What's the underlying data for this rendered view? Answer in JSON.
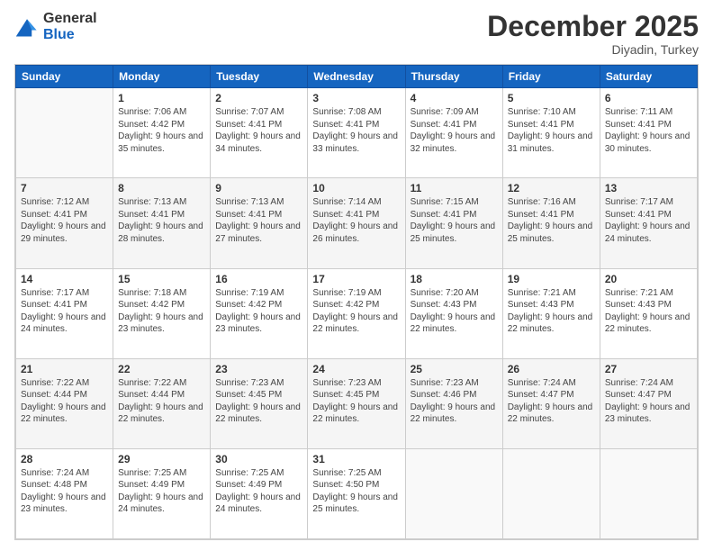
{
  "header": {
    "logo_general": "General",
    "logo_blue": "Blue",
    "month_title": "December 2025",
    "location": "Diyadin, Turkey"
  },
  "weekdays": [
    "Sunday",
    "Monday",
    "Tuesday",
    "Wednesday",
    "Thursday",
    "Friday",
    "Saturday"
  ],
  "weeks": [
    [
      {
        "day": "",
        "sunrise": "",
        "sunset": "",
        "daylight": "",
        "empty": true
      },
      {
        "day": "1",
        "sunrise": "Sunrise: 7:06 AM",
        "sunset": "Sunset: 4:42 PM",
        "daylight": "Daylight: 9 hours and 35 minutes."
      },
      {
        "day": "2",
        "sunrise": "Sunrise: 7:07 AM",
        "sunset": "Sunset: 4:41 PM",
        "daylight": "Daylight: 9 hours and 34 minutes."
      },
      {
        "day": "3",
        "sunrise": "Sunrise: 7:08 AM",
        "sunset": "Sunset: 4:41 PM",
        "daylight": "Daylight: 9 hours and 33 minutes."
      },
      {
        "day": "4",
        "sunrise": "Sunrise: 7:09 AM",
        "sunset": "Sunset: 4:41 PM",
        "daylight": "Daylight: 9 hours and 32 minutes."
      },
      {
        "day": "5",
        "sunrise": "Sunrise: 7:10 AM",
        "sunset": "Sunset: 4:41 PM",
        "daylight": "Daylight: 9 hours and 31 minutes."
      },
      {
        "day": "6",
        "sunrise": "Sunrise: 7:11 AM",
        "sunset": "Sunset: 4:41 PM",
        "daylight": "Daylight: 9 hours and 30 minutes."
      }
    ],
    [
      {
        "day": "7",
        "sunrise": "Sunrise: 7:12 AM",
        "sunset": "Sunset: 4:41 PM",
        "daylight": "Daylight: 9 hours and 29 minutes."
      },
      {
        "day": "8",
        "sunrise": "Sunrise: 7:13 AM",
        "sunset": "Sunset: 4:41 PM",
        "daylight": "Daylight: 9 hours and 28 minutes."
      },
      {
        "day": "9",
        "sunrise": "Sunrise: 7:13 AM",
        "sunset": "Sunset: 4:41 PM",
        "daylight": "Daylight: 9 hours and 27 minutes."
      },
      {
        "day": "10",
        "sunrise": "Sunrise: 7:14 AM",
        "sunset": "Sunset: 4:41 PM",
        "daylight": "Daylight: 9 hours and 26 minutes."
      },
      {
        "day": "11",
        "sunrise": "Sunrise: 7:15 AM",
        "sunset": "Sunset: 4:41 PM",
        "daylight": "Daylight: 9 hours and 25 minutes."
      },
      {
        "day": "12",
        "sunrise": "Sunrise: 7:16 AM",
        "sunset": "Sunset: 4:41 PM",
        "daylight": "Daylight: 9 hours and 25 minutes."
      },
      {
        "day": "13",
        "sunrise": "Sunrise: 7:17 AM",
        "sunset": "Sunset: 4:41 PM",
        "daylight": "Daylight: 9 hours and 24 minutes."
      }
    ],
    [
      {
        "day": "14",
        "sunrise": "Sunrise: 7:17 AM",
        "sunset": "Sunset: 4:41 PM",
        "daylight": "Daylight: 9 hours and 24 minutes."
      },
      {
        "day": "15",
        "sunrise": "Sunrise: 7:18 AM",
        "sunset": "Sunset: 4:42 PM",
        "daylight": "Daylight: 9 hours and 23 minutes."
      },
      {
        "day": "16",
        "sunrise": "Sunrise: 7:19 AM",
        "sunset": "Sunset: 4:42 PM",
        "daylight": "Daylight: 9 hours and 23 minutes."
      },
      {
        "day": "17",
        "sunrise": "Sunrise: 7:19 AM",
        "sunset": "Sunset: 4:42 PM",
        "daylight": "Daylight: 9 hours and 22 minutes."
      },
      {
        "day": "18",
        "sunrise": "Sunrise: 7:20 AM",
        "sunset": "Sunset: 4:43 PM",
        "daylight": "Daylight: 9 hours and 22 minutes."
      },
      {
        "day": "19",
        "sunrise": "Sunrise: 7:21 AM",
        "sunset": "Sunset: 4:43 PM",
        "daylight": "Daylight: 9 hours and 22 minutes."
      },
      {
        "day": "20",
        "sunrise": "Sunrise: 7:21 AM",
        "sunset": "Sunset: 4:43 PM",
        "daylight": "Daylight: 9 hours and 22 minutes."
      }
    ],
    [
      {
        "day": "21",
        "sunrise": "Sunrise: 7:22 AM",
        "sunset": "Sunset: 4:44 PM",
        "daylight": "Daylight: 9 hours and 22 minutes."
      },
      {
        "day": "22",
        "sunrise": "Sunrise: 7:22 AM",
        "sunset": "Sunset: 4:44 PM",
        "daylight": "Daylight: 9 hours and 22 minutes."
      },
      {
        "day": "23",
        "sunrise": "Sunrise: 7:23 AM",
        "sunset": "Sunset: 4:45 PM",
        "daylight": "Daylight: 9 hours and 22 minutes."
      },
      {
        "day": "24",
        "sunrise": "Sunrise: 7:23 AM",
        "sunset": "Sunset: 4:45 PM",
        "daylight": "Daylight: 9 hours and 22 minutes."
      },
      {
        "day": "25",
        "sunrise": "Sunrise: 7:23 AM",
        "sunset": "Sunset: 4:46 PM",
        "daylight": "Daylight: 9 hours and 22 minutes."
      },
      {
        "day": "26",
        "sunrise": "Sunrise: 7:24 AM",
        "sunset": "Sunset: 4:47 PM",
        "daylight": "Daylight: 9 hours and 22 minutes."
      },
      {
        "day": "27",
        "sunrise": "Sunrise: 7:24 AM",
        "sunset": "Sunset: 4:47 PM",
        "daylight": "Daylight: 9 hours and 23 minutes."
      }
    ],
    [
      {
        "day": "28",
        "sunrise": "Sunrise: 7:24 AM",
        "sunset": "Sunset: 4:48 PM",
        "daylight": "Daylight: 9 hours and 23 minutes."
      },
      {
        "day": "29",
        "sunrise": "Sunrise: 7:25 AM",
        "sunset": "Sunset: 4:49 PM",
        "daylight": "Daylight: 9 hours and 24 minutes."
      },
      {
        "day": "30",
        "sunrise": "Sunrise: 7:25 AM",
        "sunset": "Sunset: 4:49 PM",
        "daylight": "Daylight: 9 hours and 24 minutes."
      },
      {
        "day": "31",
        "sunrise": "Sunrise: 7:25 AM",
        "sunset": "Sunset: 4:50 PM",
        "daylight": "Daylight: 9 hours and 25 minutes."
      },
      {
        "day": "",
        "sunrise": "",
        "sunset": "",
        "daylight": "",
        "empty": true
      },
      {
        "day": "",
        "sunrise": "",
        "sunset": "",
        "daylight": "",
        "empty": true
      },
      {
        "day": "",
        "sunrise": "",
        "sunset": "",
        "daylight": "",
        "empty": true
      }
    ]
  ]
}
